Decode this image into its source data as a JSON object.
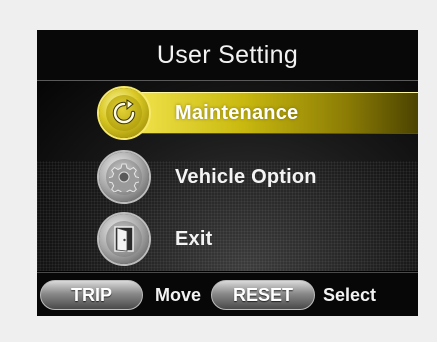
{
  "screen": {
    "title": "User Setting"
  },
  "menu": {
    "items": [
      {
        "label": "Maintenance",
        "icon": "maintenance-icon",
        "selected": true
      },
      {
        "label": "Vehicle Option",
        "icon": "gear-icon",
        "selected": false
      },
      {
        "label": "Exit",
        "icon": "exit-door-icon",
        "selected": false
      }
    ]
  },
  "footer": {
    "trip_button": "TRIP",
    "trip_hint": "Move",
    "reset_button": "RESET",
    "reset_hint": "Select"
  },
  "colors": {
    "highlight": "#e6d52e",
    "background": "#000000",
    "page": "#efefef"
  }
}
